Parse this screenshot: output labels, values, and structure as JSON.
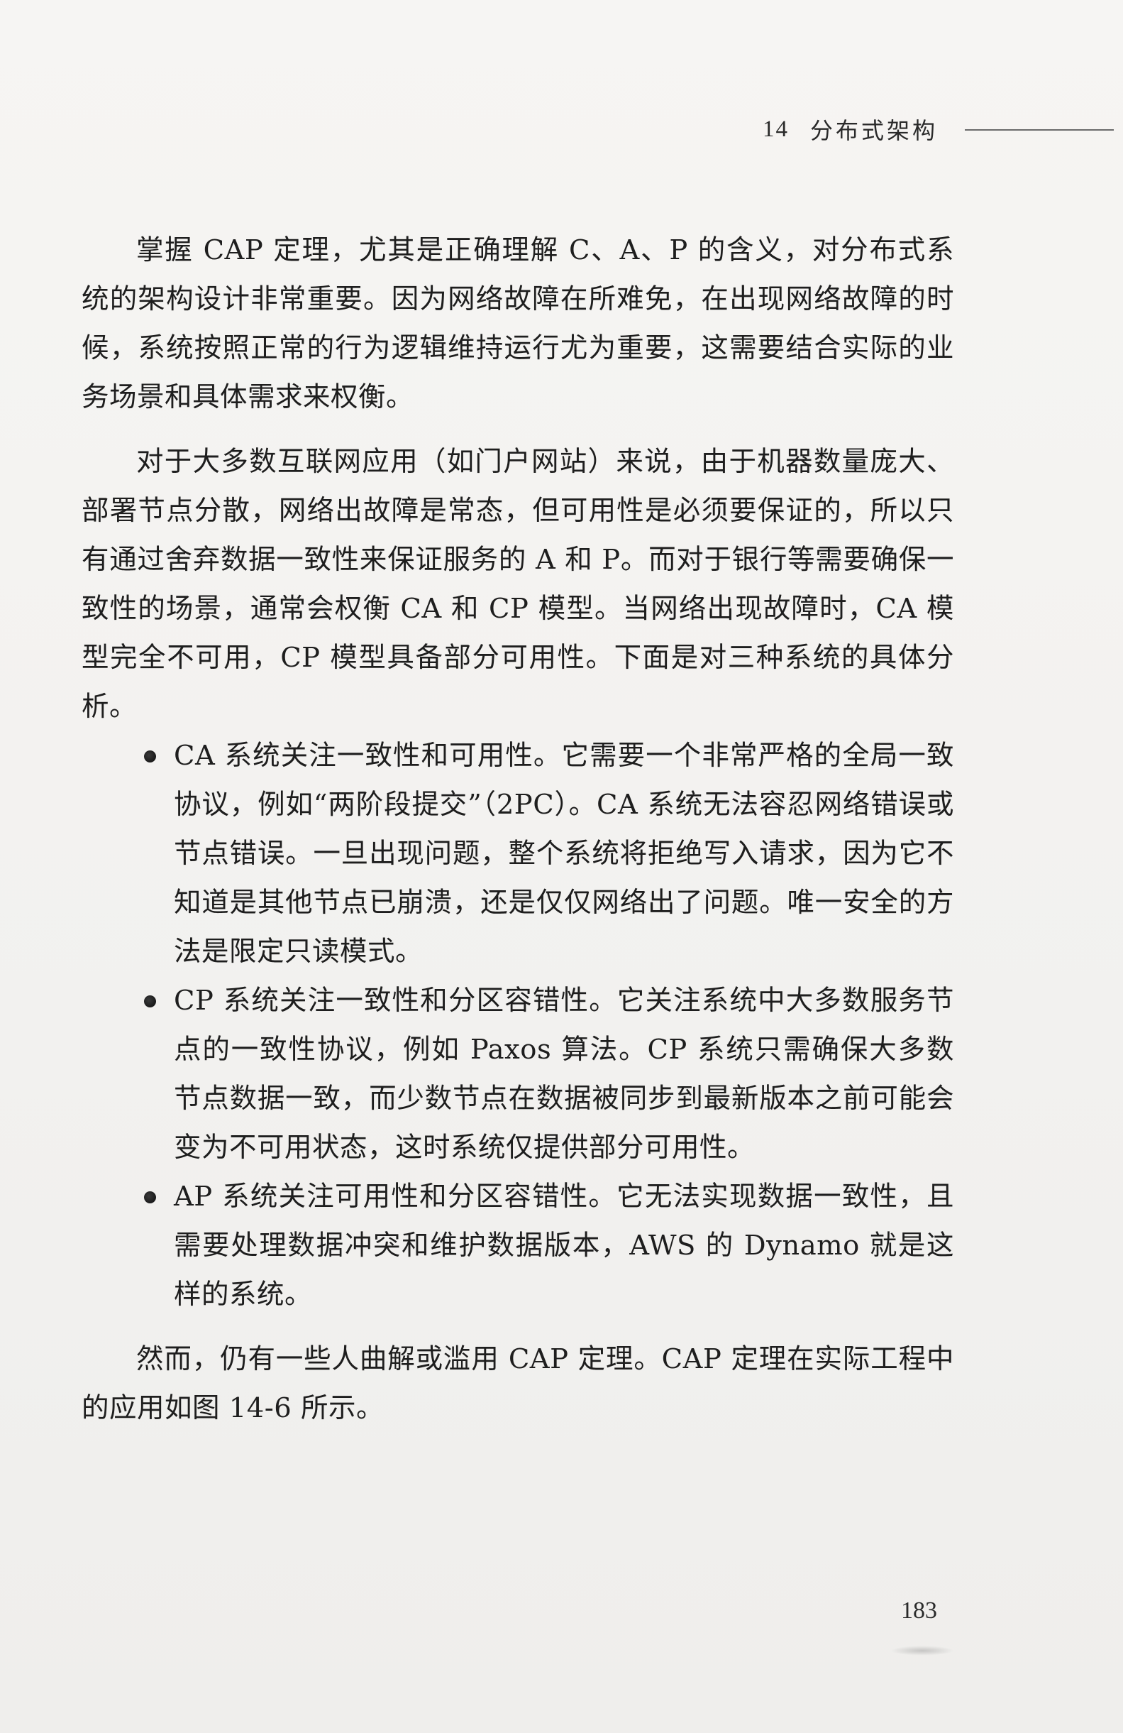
{
  "header": {
    "chapter_number": "14",
    "chapter_title": "分布式架构"
  },
  "paragraphs": [
    "掌握 CAP 定理，尤其是正确理解 C、A、P 的含义，对分布式系统的架构设计非常重要。因为网络故障在所难免，在出现网络故障的时候，系统按照正常的行为逻辑维持运行尤为重要，这需要结合实际的业务场景和具体需求来权衡。",
    "对于大多数互联网应用（如门户网站）来说，由于机器数量庞大、部署节点分散，网络出故障是常态，但可用性是必须要保证的，所以只有通过舍弃数据一致性来保证服务的 A 和 P。而对于银行等需要确保一致性的场景，通常会权衡 CA 和 CP 模型。当网络出现故障时，CA 模型完全不可用，CP 模型具备部分可用性。下面是对三种系统的具体分析。"
  ],
  "bullets": [
    "CA 系统关注一致性和可用性。它需要一个非常严格的全局一致协议，例如“两阶段提交”（2PC）。CA 系统无法容忍网络错误或节点错误。一旦出现问题，整个系统将拒绝写入请求，因为它不知道是其他节点已崩溃，还是仅仅网络出了问题。唯一安全的方法是限定只读模式。",
    "CP 系统关注一致性和分区容错性。它关注系统中大多数服务节点的一致性协议，例如 Paxos 算法。CP 系统只需确保大多数节点数据一致，而少数节点在数据被同步到最新版本之前可能会变为不可用状态，这时系统仅提供部分可用性。",
    "AP 系统关注可用性和分区容错性。它无法实现数据一致性，且需要处理数据冲突和维护数据版本，AWS 的 Dynamo 就是这样的系统。"
  ],
  "closing_paragraph": "然而，仍有一些人曲解或滥用 CAP 定理。CAP 定理在实际工程中的应用如图 14-6 所示。",
  "footer": {
    "page_number": "183"
  }
}
